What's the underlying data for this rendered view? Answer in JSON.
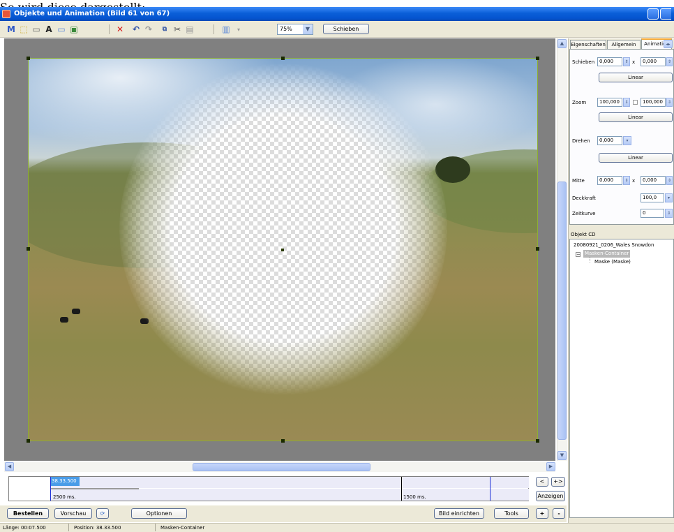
{
  "caption": "So wird diese dargestellt:",
  "window": {
    "title": "Objekte und Animation  (Bild 61 von 67)"
  },
  "toolbar": {
    "zoom_value": "75%",
    "move_button": "Schieben"
  },
  "timeline": {
    "selected_time": "38.33.500",
    "left_duration": "2500 ms.",
    "right_duration": "1500 ms."
  },
  "timeline_nav": {
    "prev": "<",
    "next": "+>",
    "fit": "Anzeigen"
  },
  "bottom_buttons": {
    "order": "Bestellen",
    "preview": "Vorschau",
    "options": "Optionen",
    "setup_image": "Bild einrichten",
    "tools": "Tools",
    "plus": "+",
    "minus": "-"
  },
  "statusbar": {
    "length": "Länge: 00:07.500",
    "position": "Position: 38.33.500",
    "object": "Masken-Container"
  },
  "panel": {
    "tabs": [
      "Eigenschaften",
      "Allgemein",
      "Animation"
    ],
    "move_label": "Schieben",
    "move_x": "0,000",
    "move_y": "0,000",
    "move_x_sep": "x",
    "move_mode": "Linear",
    "zoom_label": "Zoom",
    "zoom_x": "100,000",
    "zoom_y": "100,000",
    "zoom_mode": "Linear",
    "rotate_label": "Drehen",
    "rotate_value": "0,000",
    "rotate_mode": "Linear",
    "center_label": "Mitte",
    "center_x": "0,000",
    "center_y": "0,000",
    "opacity_label": "Deckkraft",
    "opacity_value": "100,0",
    "timeline_label": "Zeitkurve",
    "timeline_value": "0"
  },
  "objects": {
    "header": "Objekt CD",
    "items": [
      "20080921_0206_Wales Snowdon",
      "Masken-Container",
      "Maske (Maske)"
    ]
  }
}
